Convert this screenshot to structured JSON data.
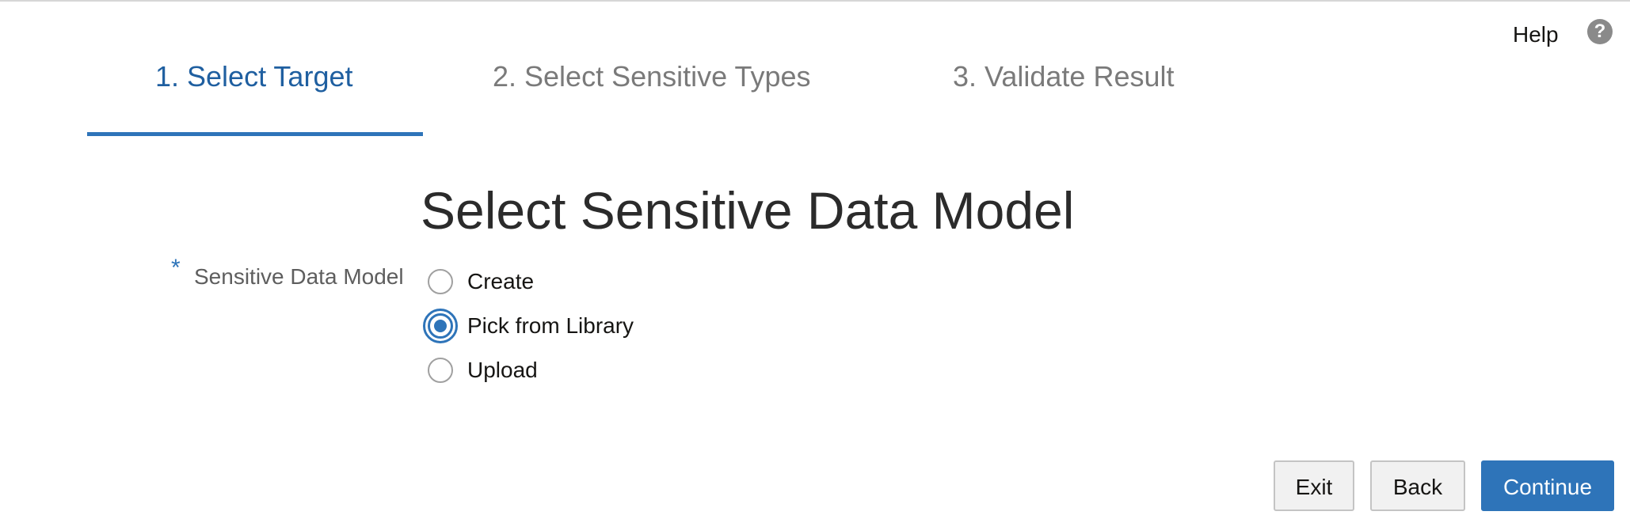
{
  "header": {
    "help_label": "Help",
    "help_icon": "?"
  },
  "train": {
    "steps": [
      {
        "label": "1. Select Target",
        "state": "active"
      },
      {
        "label": "2. Select Sensitive Types",
        "state": "inactive"
      },
      {
        "label": "3. Validate Result",
        "state": "inactive"
      }
    ]
  },
  "main": {
    "title": "Select Sensitive Data Model",
    "field": {
      "required_marker": "*",
      "label": "Sensitive Data Model",
      "options": [
        {
          "label": "Create",
          "selected": false
        },
        {
          "label": "Pick from Library",
          "selected": true
        },
        {
          "label": "Upload",
          "selected": false
        }
      ]
    }
  },
  "footer": {
    "exit_label": "Exit",
    "back_label": "Back",
    "continue_label": "Continue"
  },
  "colors": {
    "accent": "#2e74b9",
    "active_step_text": "#1f5fa0",
    "inactive_step_text": "#7a7a7a"
  },
  "icons": {
    "help": "help-icon",
    "radio": "radio-icon"
  }
}
